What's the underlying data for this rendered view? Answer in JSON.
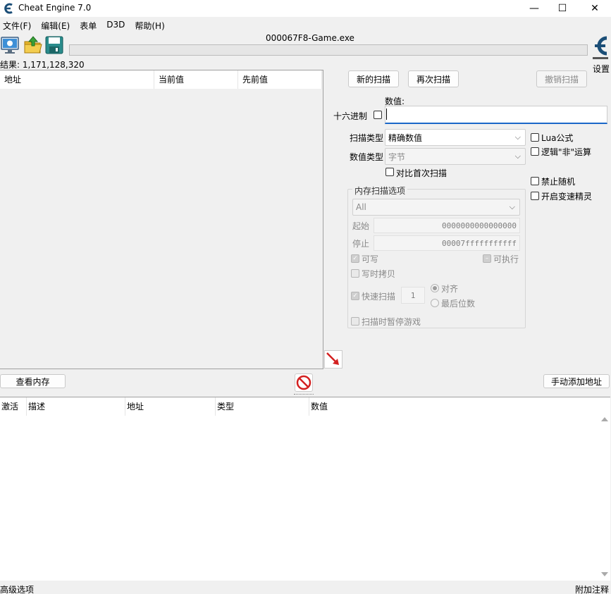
{
  "window": {
    "title": "Cheat Engine 7.0",
    "minimize": "—",
    "maximize": "☐",
    "close": "✕"
  },
  "menu": [
    "文件(F)",
    "编辑(E)",
    "表单",
    "D3D",
    "帮助(H)"
  ],
  "toolbar": {
    "process_name": "000067F8-Game.exe",
    "settings_label": "设置"
  },
  "result_count": "结果: 1,171,128,320",
  "scan_list": {
    "columns": [
      "地址",
      "当前值",
      "先前值"
    ]
  },
  "scan_panel": {
    "new_scan": "新的扫描",
    "next_scan": "再次扫描",
    "undo_scan": "撤销扫描",
    "value_label": "数值:",
    "hex_label": "十六进制",
    "value": "",
    "scan_type_label": "扫描类型",
    "scan_type_value": "精确数值",
    "value_type_label": "数值类型",
    "value_type_value": "字节",
    "compare_first": "对比首次扫描",
    "lua_formula": "Lua公式",
    "not_operator": "逻辑\"非\"运算",
    "disable_random": "禁止随机",
    "speedhack": "开启变速精灵"
  },
  "memory_options": {
    "title": "内存扫描选项",
    "region": "All",
    "start_label": "起始",
    "start_value": "0000000000000000",
    "stop_label": "停止",
    "stop_value": "00007fffffffffff",
    "writable": "可写",
    "executable": "可执行",
    "copy_on_write": "写时拷贝",
    "fast_scan": "快速扫描",
    "fast_scan_value": "1",
    "alignment": "对齐",
    "last_digits": "最后位数",
    "pause_game": "扫描时暂停游戏"
  },
  "actions": {
    "memory_view": "查看内存",
    "add_manual": "手动添加地址"
  },
  "address_list": {
    "columns": [
      "激活",
      "描述",
      "地址",
      "类型",
      "数值"
    ]
  },
  "status": {
    "advanced": "高级选项",
    "comments": "附加注释"
  },
  "colors": {
    "accent": "#1a67c8",
    "arrow": "#d32020",
    "no_entry": "#d32020"
  }
}
